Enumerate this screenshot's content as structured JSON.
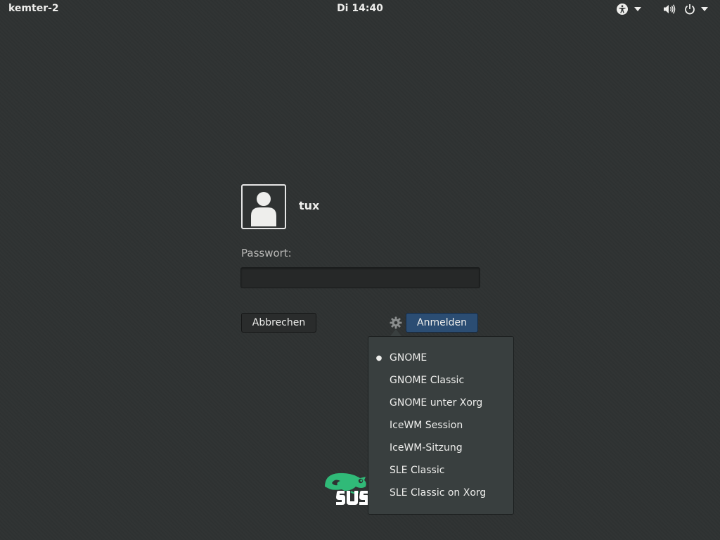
{
  "topbar": {
    "hostname": "kemter-2",
    "clock": "Di 14:40",
    "icons": {
      "accessibility": "accessibility-icon",
      "volume": "volume-icon",
      "power": "power-icon",
      "caret": "chevron-down-icon"
    }
  },
  "login": {
    "username": "tux",
    "password_label": "Passwort:",
    "password_value": "",
    "cancel_label": "Abbrechen",
    "submit_label": "Anmelden",
    "session_icon": "gear-icon"
  },
  "session_menu": {
    "items": [
      {
        "label": "GNOME",
        "selected": true
      },
      {
        "label": "GNOME Classic",
        "selected": false
      },
      {
        "label": "GNOME unter Xorg",
        "selected": false
      },
      {
        "label": "IceWM Session",
        "selected": false
      },
      {
        "label": "IceWM-Sitzung",
        "selected": false
      },
      {
        "label": "SLE Classic",
        "selected": false
      },
      {
        "label": "SLE Classic on Xorg",
        "selected": false
      }
    ]
  },
  "branding": {
    "logo_text": "SUSE",
    "logo_color": "#30ba78"
  },
  "colors": {
    "background": "#2f3232",
    "accent_button": "#2b4d73",
    "menu_bg": "#393f3f"
  }
}
